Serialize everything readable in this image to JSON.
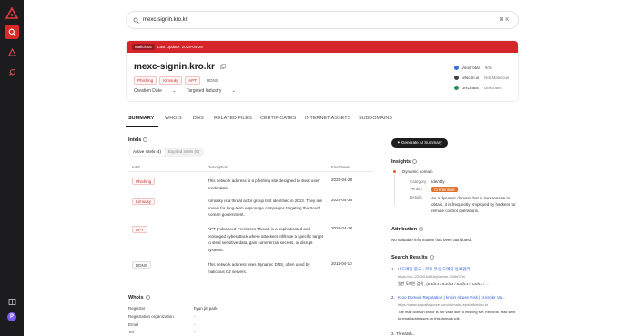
{
  "search": {
    "query": "mexc-signin.kro.kr",
    "shortcut": "⌘ K"
  },
  "header": {
    "status_badge": "Malicious",
    "last_update": "Last Update: 2025-04-28",
    "domain": "mexc-signin.kro.kr",
    "tags": [
      "Phishing",
      "Kimsuky",
      "APT",
      "DDNS"
    ],
    "creation_date_label": "Creation Date",
    "targeted_industry_label": "Targeted Industry",
    "reputation": [
      {
        "source": "VirusTotal",
        "value": "9/94",
        "color": "#3b6ee0"
      },
      {
        "source": "urlscan.io",
        "value": "Not Malicious",
        "color": "#444444"
      },
      {
        "source": "URLhaus",
        "value": "Unknown",
        "color": "#2b8a5a"
      }
    ]
  },
  "tabs": [
    "SUMMARY",
    "WHOIS",
    "DNS",
    "RELATED FILES",
    "CERTIFICATES",
    "INTERNET ASSETS",
    "SUBDOMAINS"
  ],
  "intels": {
    "title": "Intels",
    "filter_active": "Active Intels (4)",
    "filter_expired": "Expired Intels (0)",
    "columns": [
      "Intel",
      "Description",
      "First Seen"
    ],
    "rows": [
      {
        "intel": "Phishing",
        "description": "This network address is a phishing site designed to steal user credentials.",
        "first_seen": "2025-04-28"
      },
      {
        "intel": "Kimsuky",
        "description": "Kimsuky is a threat actor group first identified in 2013. They are known for long-term espionage campaigns targeting the South Korean government.",
        "first_seen": "2025-04-28"
      },
      {
        "intel": "APT",
        "description": "APT (Advanced Persistent Threat) is a sophisticated and prolonged cyberattack where attackers infiltrate a specific target to steal sensitive data, gain commercial secrets, or disrupt systems.",
        "first_seen": "2025-04-28"
      },
      {
        "intel": "DDNS",
        "description": "This network address uses Dynamic DNS, often used by malicious C2 servers.",
        "first_seen": "2011-04-10"
      }
    ]
  },
  "whois": {
    "title": "Whois",
    "rows": [
      {
        "label": "Registrar",
        "value": "hyun jin park"
      },
      {
        "label": "Registration organization",
        "value": "-"
      },
      {
        "label": "Email",
        "value": "-"
      },
      {
        "label": "Tel",
        "value": "-"
      }
    ]
  },
  "right": {
    "generate_label": "Generate AI Summary",
    "insights_title": "Insights",
    "insight_name": "Dynamic domain",
    "category_label": "Category",
    "category_value": "Identify",
    "verdict_label": "Verdict",
    "verdict_value": "Credentials",
    "details_label": "Details",
    "details_value": "As a dynamic domain that is inexpensive to obtain, it is frequently employed by hackers for remote control operations.",
    "attribution_title": "Attribution",
    "attribution_text": "No valuable information has been attributed.",
    "search_results_title": "Search Results",
    "results": [
      {
        "title": "내도메인 한국 - 무료 무상 도메인 등록관리",
        "url": "https://xn--220b31d81hq5avxm-3e0b07fe/",
        "snippet": "일반 도메인 검색 , (a-z/A-z / a-z/A-z / a-z/A-z / a-z/A-z / ..."
      },
      {
        "title": "Kroo Domain Reputation | kro.kr Abuse Risk | kr.kro.kr Val...",
        "url": "https://www.ipqualityscore.com/domain-reputation/kro.kr",
        "snippet": "The mail domain kro.kr is not valid due to missing MX Records. Mail sent to email addresses on this domain will..."
      }
    ],
    "third_result_label": "3. Threatsh..."
  }
}
